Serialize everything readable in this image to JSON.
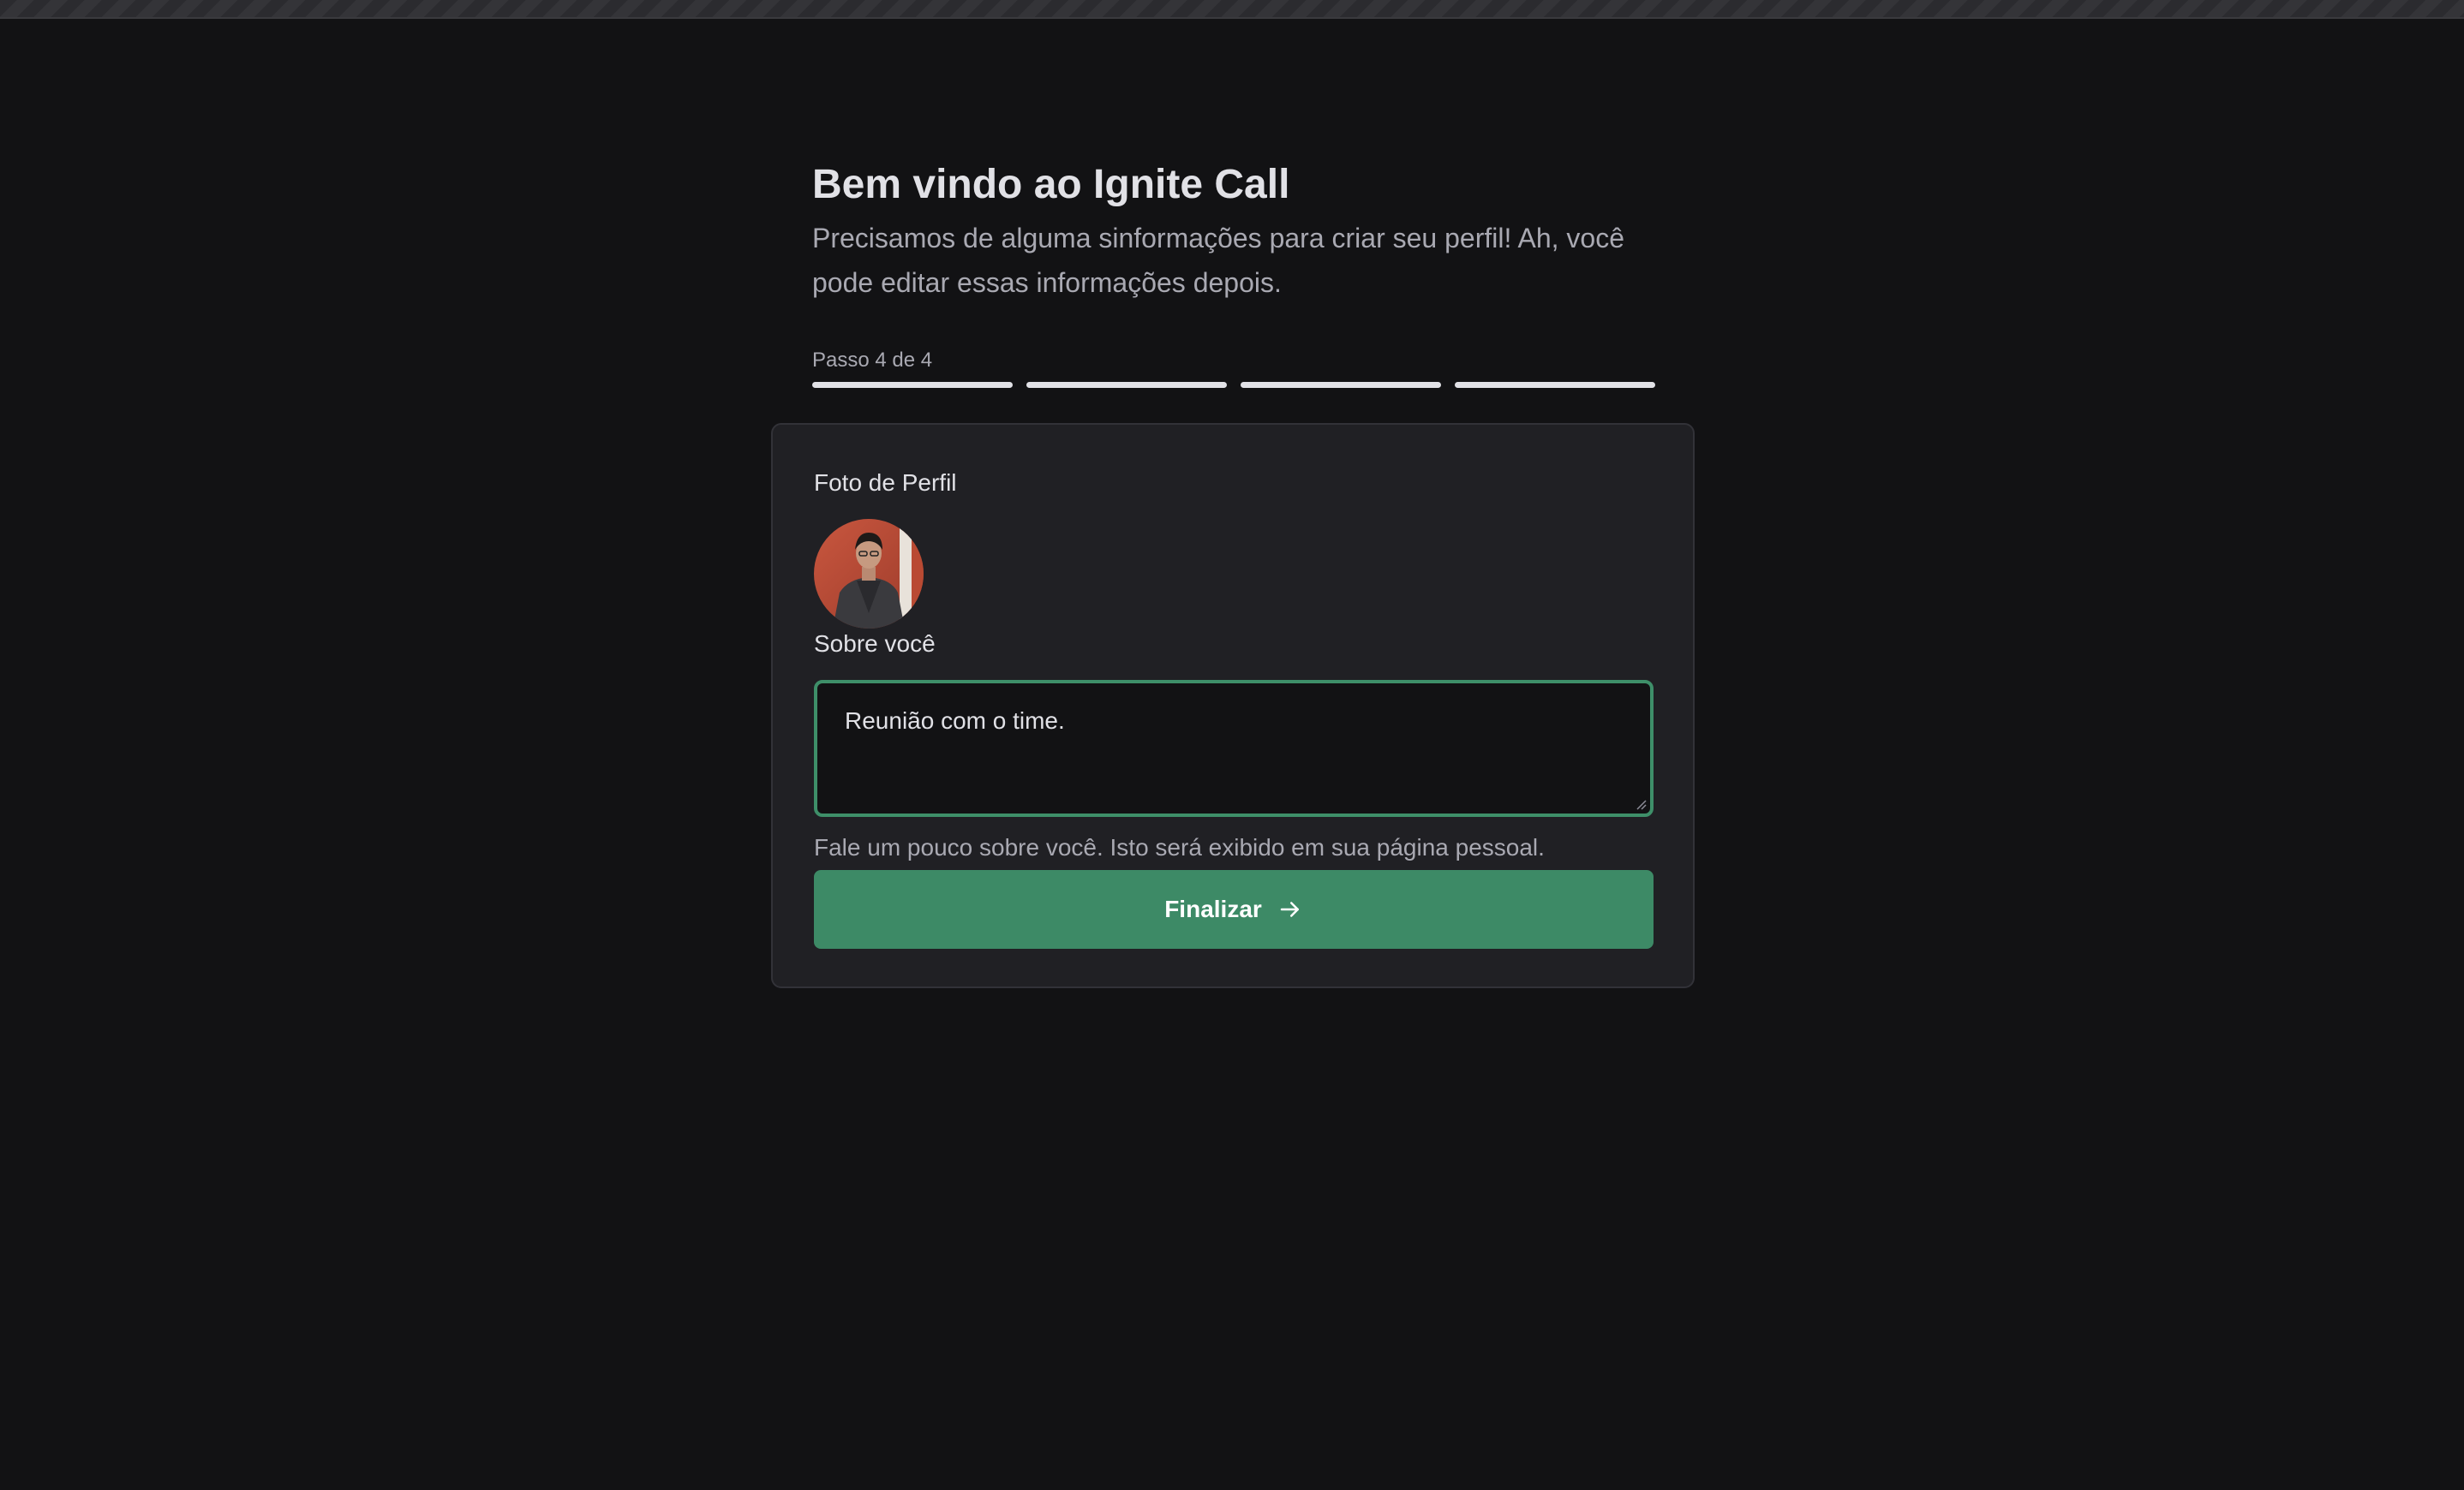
{
  "header": {
    "title": "Bem vindo ao Ignite Call",
    "subtitle": "Precisamos de alguma sinformações para criar seu perfil! Ah, você pode editar essas informações depois."
  },
  "stepper": {
    "label": "Passo 4 de 4",
    "current": 4,
    "total": 4
  },
  "form": {
    "photo_label": "Foto de Perfil",
    "about_label": "Sobre você",
    "about_value": "Reunião com o time.",
    "help_text": "Fale um pouco sobre você. Isto será exibido em sua página pessoal.",
    "submit_label": "Finalizar",
    "submit_icon": "arrow-right-icon"
  },
  "colors": {
    "background": "#121214",
    "card": "#202024",
    "accent": "#3D8A66",
    "focus_border": "#3E8F69",
    "text": "#E1E1E6",
    "muted": "#A9A9B2"
  }
}
